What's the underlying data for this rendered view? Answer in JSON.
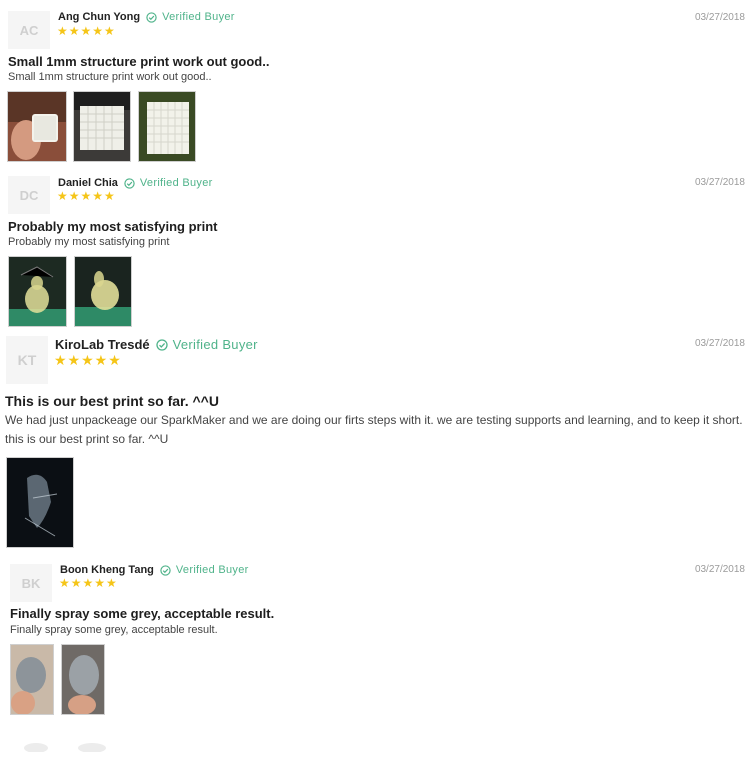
{
  "reviews": [
    {
      "initials": "AC",
      "author": "Ang Chun Yong",
      "verified_label": "Verified  Buyer",
      "rating": 5,
      "stars": "★★★★★",
      "date": "03/27/2018",
      "title": "Small 1mm structure print work out good..",
      "body": "Small 1mm structure print work out good..",
      "photos": [
        "photo-1",
        "photo-2",
        "photo-3"
      ]
    },
    {
      "initials": "DC",
      "author": "Daniel Chia",
      "verified_label": "Verified  Buyer",
      "rating": 5,
      "stars": "★★★★★",
      "date": "03/27/2018",
      "title": "Probably my most satisfying print",
      "body": "Probably my most satisfying print",
      "photos": [
        "photo-1",
        "photo-2"
      ]
    },
    {
      "initials": "KT",
      "author": "KiroLab Tresdé",
      "verified_label": "Verified  Buyer",
      "rating": 5,
      "stars": "★★★★★",
      "date": "03/27/2018",
      "title": "This is our best print so far. ^^U",
      "body": "We had just unpackeage our SparkMaker and we are doing our firts steps with it. we are testing supports and learning, and to keep it short. this is our best print so far. ^^U",
      "photos": [
        "photo-1"
      ]
    },
    {
      "initials": "BK",
      "author": "Boon Kheng Tang",
      "verified_label": "Verified  Buyer",
      "rating": 5,
      "stars": "★★★★★",
      "date": "03/27/2018",
      "title": "Finally spray some grey, acceptable result.",
      "body": "Finally spray some grey, acceptable result.",
      "photos": [
        "photo-1",
        "photo-2"
      ]
    }
  ],
  "colors": {
    "verified": "#4fb38a",
    "star": "#f5c518",
    "date": "#9b9b9b"
  }
}
